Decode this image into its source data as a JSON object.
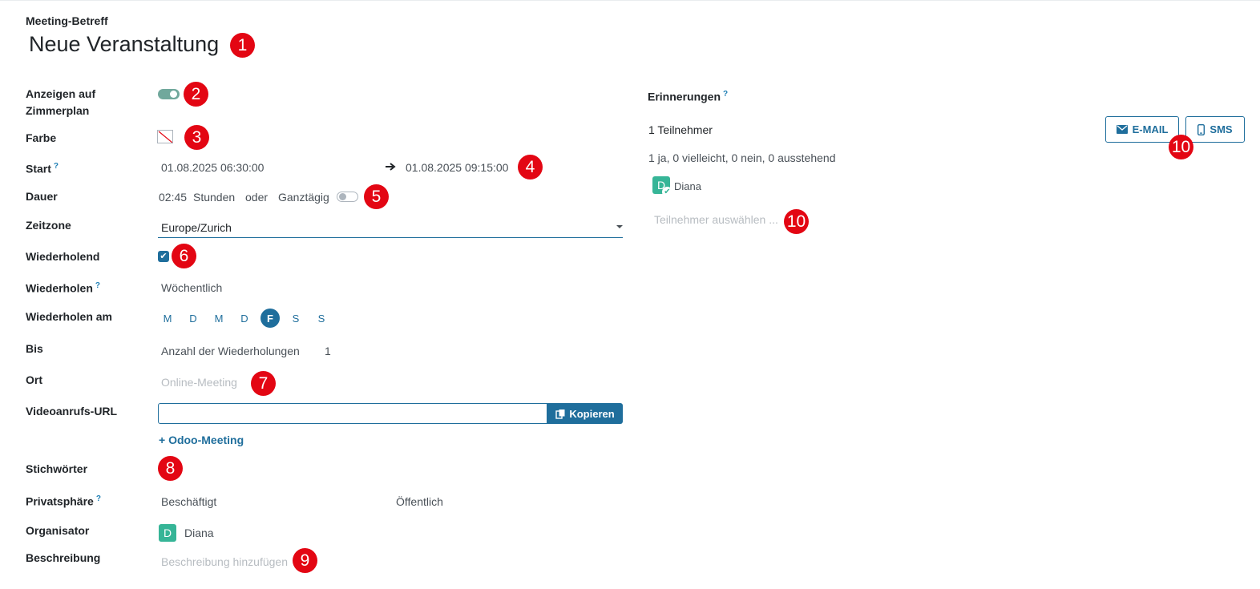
{
  "header": {
    "subject_label": "Meeting-Betreff",
    "title": "Neue Veranstaltung"
  },
  "fields": {
    "show_on_room_plan": {
      "label_line1": "Anzeigen auf",
      "label_line2": "Zimmerplan",
      "value": true
    },
    "color": {
      "label": "Farbe"
    },
    "start": {
      "label": "Start",
      "help": "?",
      "start_value": "01.08.2025 06:30:00",
      "end_value": "01.08.2025 09:15:00"
    },
    "duration": {
      "label": "Dauer",
      "value": "02:45",
      "unit": "Stunden",
      "or": "oder",
      "all_day_label": "Ganztägig",
      "all_day": false
    },
    "timezone": {
      "label": "Zeitzone",
      "value": "Europe/Zurich"
    },
    "recurring": {
      "label": "Wiederholend",
      "checked": true
    },
    "repeat": {
      "label": "Wiederholen",
      "help": "?",
      "value": "Wöchentlich"
    },
    "repeat_on": {
      "label": "Wiederholen am",
      "days": [
        "M",
        "D",
        "M",
        "D",
        "F",
        "S",
        "S"
      ],
      "active_index": 4
    },
    "until": {
      "label": "Bis",
      "value": "Anzahl der Wiederholungen",
      "count": "1"
    },
    "location": {
      "label": "Ort",
      "placeholder": "Online-Meeting"
    },
    "video_url": {
      "label": "Videoanrufs-URL",
      "copy_label": "Kopieren",
      "add_link": "+ Odoo-Meeting"
    },
    "tags": {
      "label": "Stichwörter"
    },
    "privacy": {
      "label": "Privatsphäre",
      "help": "?",
      "value1": "Beschäftigt",
      "value2": "Öffentlich"
    },
    "organizer": {
      "label": "Organisator",
      "initial": "D",
      "name": "Diana"
    },
    "description": {
      "label": "Beschreibung",
      "placeholder": "Beschreibung hinzufügen"
    }
  },
  "reminders": {
    "label": "Erinnerungen",
    "help": "?",
    "attendee_count": "1 Teilnehmer",
    "email_label": "E-MAIL",
    "sms_label": "SMS",
    "status_summary": "1 ja, 0 vielleicht, 0 nein, 0 ausstehend",
    "attendee": {
      "initial": "D",
      "name": "Diana"
    },
    "select_placeholder": "Teilnehmer auswählen ..."
  },
  "badges": [
    "1",
    "2",
    "3",
    "4",
    "5",
    "6",
    "7",
    "8",
    "9",
    "10",
    "10"
  ],
  "icons": {
    "arrow": "arrow-right-icon",
    "copy": "copy-icon",
    "mail": "envelope-icon",
    "phone": "mobile-icon",
    "check": "check-icon"
  },
  "colors": {
    "primary": "#1f6e9c",
    "toggle_on": "#71a89c",
    "avatar": "#36b597",
    "badge": "#e30613"
  }
}
